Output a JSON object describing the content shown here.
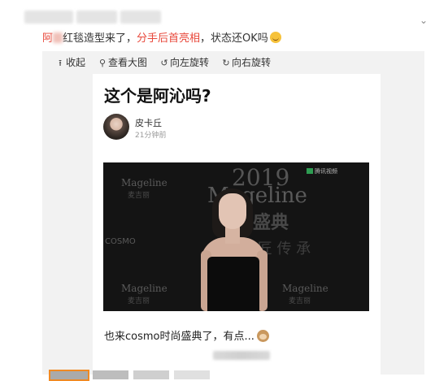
{
  "post": {
    "caption_prefix": "阿",
    "caption_middle": "红毯造型来了，",
    "caption_highlight": "分手后首亮相",
    "caption_suffix": "，状态还OK吗"
  },
  "toolbar": {
    "collapse": {
      "icon": "collapse-up-icon",
      "label": "收起"
    },
    "view_large": {
      "icon": "magnifier-icon",
      "label": "查看大图"
    },
    "rotate_left": {
      "icon": "rotate-left-icon",
      "label": "向左旋转"
    },
    "rotate_right": {
      "icon": "rotate-right-icon",
      "label": "向右旋转"
    }
  },
  "article": {
    "title": "这个是阿沁吗?",
    "author": "皮卡丘",
    "time": "21分钟前",
    "photo": {
      "year": "2019",
      "brand": "Mageline",
      "brand_cn": "麦吉丽",
      "event": "美丽盛典",
      "slogan": "美 匠 传 承",
      "sponsor": "COSMO",
      "video_logo": "腾讯视频"
    },
    "text": "也来cosmo时尚盛典了，有点..."
  },
  "colors": {
    "highlight": "#e8473a",
    "thumb_active": "#f08a24"
  }
}
